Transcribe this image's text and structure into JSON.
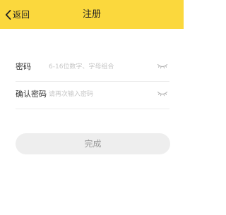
{
  "header": {
    "back_label": "返回",
    "title": "注册",
    "background": "#fbd83d"
  },
  "form": {
    "password": {
      "label": "密码",
      "placeholder": "6-16位数字、字母组合",
      "value": "",
      "toggle_icon": "eye-closed-icon"
    },
    "confirm_password": {
      "label": "确认密码",
      "placeholder": "请再次输入密码",
      "value": "",
      "toggle_icon": "eye-closed-icon"
    }
  },
  "submit": {
    "label": "完成",
    "background": "#eeeeee",
    "text_color": "#9a9a9a"
  }
}
